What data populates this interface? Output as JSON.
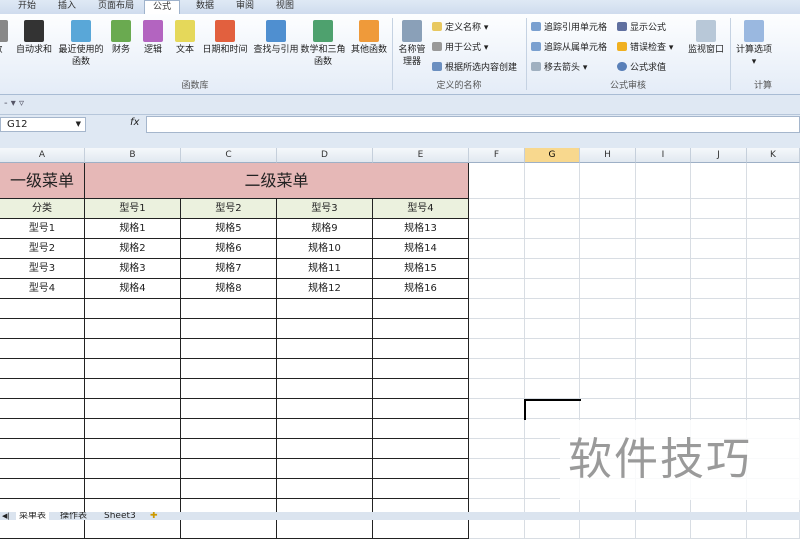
{
  "ribbon_tabs": [
    "开始",
    "插入",
    "页面布局",
    "公式",
    "数据",
    "审阅",
    "视图"
  ],
  "active_tab": "公式",
  "function_library": {
    "buttons": [
      {
        "label": "数",
        "color": "#888"
      },
      {
        "label": "自动求和",
        "color": "#333"
      },
      {
        "label": "最近使用的函数",
        "color": "#59a7d8"
      },
      {
        "label": "财务",
        "color": "#6aaa50"
      },
      {
        "label": "逻辑",
        "color": "#b364c0"
      },
      {
        "label": "文本",
        "color": "#e5d85a"
      },
      {
        "label": "日期和时间",
        "color": "#e2603e"
      },
      {
        "label": "查找与引用",
        "color": "#4f8fd0"
      },
      {
        "label": "数学和三角函数",
        "color": "#4ea16e"
      },
      {
        "label": "其他函数",
        "color": "#ef9a3a"
      }
    ],
    "group": "函数库"
  },
  "defined_names": {
    "manager": "名称管理器",
    "define": "定义名称",
    "use_in_formula": "用于公式",
    "create_from_selection": "根据所选内容创建",
    "group": "定义的名称"
  },
  "formula_auditing": {
    "trace_precedents": "追踪引用单元格",
    "trace_dependents": "追踪从属单元格",
    "remove_arrows": "移去箭头",
    "show_formulas": "显示公式",
    "error_checking": "错误检查",
    "evaluate_formula": "公式求值",
    "watch_window": "监视窗口",
    "group": "公式审核"
  },
  "calculation": {
    "options": "计算选项",
    "group": "计算"
  },
  "name_box": "G12",
  "fx_label": "fx",
  "columns": [
    "A",
    "B",
    "C",
    "D",
    "E",
    "F",
    "G",
    "H",
    "I",
    "J",
    "K"
  ],
  "selected_column": "G",
  "table": {
    "title_left": "一级菜单",
    "title_right": "二级菜单",
    "headers": [
      "分类",
      "型号1",
      "型号2",
      "型号3",
      "型号4"
    ],
    "rows": [
      [
        "型号1",
        "规格1",
        "规格5",
        "规格9",
        "规格13"
      ],
      [
        "型号2",
        "规格2",
        "规格6",
        "规格10",
        "规格14"
      ],
      [
        "型号3",
        "规格3",
        "规格7",
        "规格11",
        "规格15"
      ],
      [
        "型号4",
        "规格4",
        "规格8",
        "规格12",
        "规格16"
      ]
    ]
  },
  "sheet_tabs": [
    "菜单表",
    "操作表",
    "Sheet3"
  ],
  "watermark": "软件技巧",
  "colors": {
    "title_fill": "#e6b8b7",
    "header_fill": "#ebf1de",
    "selection": "#000000"
  }
}
